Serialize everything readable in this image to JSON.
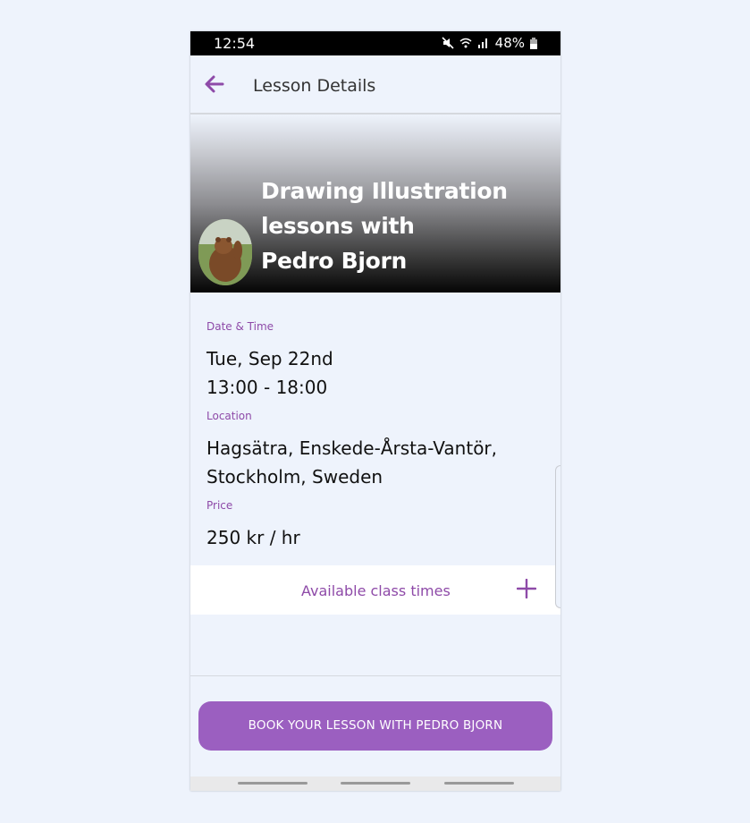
{
  "status_bar": {
    "time": "12:54",
    "battery": "48%",
    "icons": [
      "mute-icon",
      "wifi-icon",
      "signal-icon",
      "battery-icon"
    ]
  },
  "header": {
    "title": "Lesson Details",
    "back_icon": "arrow-left-icon"
  },
  "hero": {
    "title_lines": [
      "Drawing Illustration",
      "lessons with",
      "Pedro Bjorn"
    ],
    "avatar": "bear-avatar"
  },
  "details": {
    "date_time_label": "Date & Time",
    "date": "Tue, Sep 22nd",
    "time": "13:00 - 18:00",
    "location_label": "Location",
    "location_line1": "Hagsätra, Enskede-Årsta-Vantör,",
    "location_line2": "Stockholm, Sweden",
    "price_label": "Price",
    "price": "250 kr / hr"
  },
  "class_times": {
    "label": "Available class times",
    "icon": "plus-icon"
  },
  "book_button": {
    "label": "BOOK YOUR LESSON WITH PEDRO BJORN"
  },
  "colors": {
    "accent": "#8e4aa8",
    "button": "#9b5fc0",
    "background": "#eef3fc"
  }
}
